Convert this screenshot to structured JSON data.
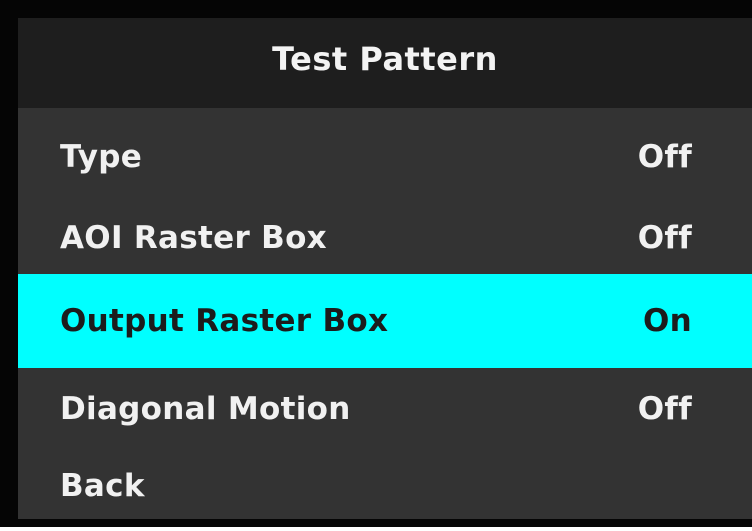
{
  "menu": {
    "title": "Test Pattern",
    "items": [
      {
        "label": "Type",
        "value": "Off",
        "selected": false
      },
      {
        "label": "AOI Raster Box",
        "value": "Off",
        "selected": false
      },
      {
        "label": "Output Raster Box",
        "value": "On",
        "selected": true
      },
      {
        "label": "Diagonal Motion",
        "value": "Off",
        "selected": false
      },
      {
        "label": "Back",
        "value": "",
        "selected": false
      }
    ]
  },
  "colors": {
    "background": "#333333",
    "header_background": "#1e1e1e",
    "frame": "#050505",
    "selection": "#00ffff",
    "text": "#f1f1f1",
    "selected_text": "#1c1c1c"
  }
}
